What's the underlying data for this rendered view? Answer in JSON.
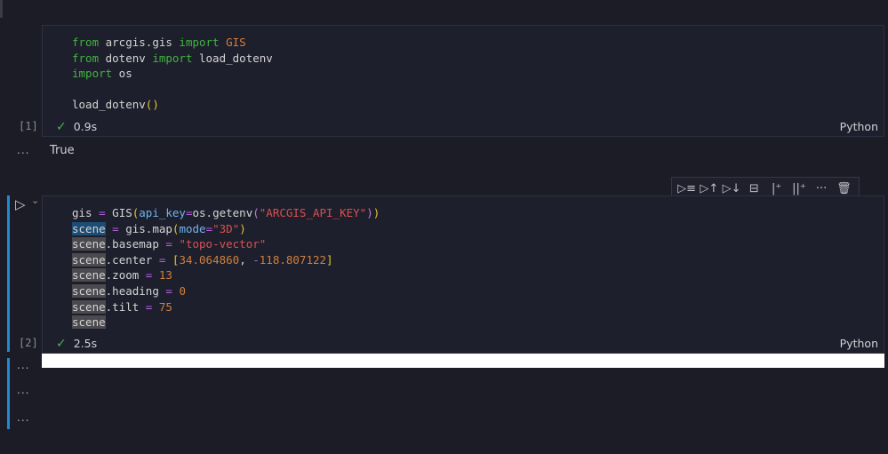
{
  "cells": [
    {
      "count": "[1]",
      "time": "0.9s",
      "language": "Python",
      "lines": [
        [
          [
            "from",
            "kw"
          ],
          [
            " arcgis.gis ",
            ""
          ],
          [
            "import",
            "kw"
          ],
          [
            " ",
            ""
          ],
          [
            "GIS",
            "cls"
          ]
        ],
        [
          [
            "from",
            "kw"
          ],
          [
            " dotenv ",
            ""
          ],
          [
            "import",
            "kw"
          ],
          [
            " load_dotenv",
            ""
          ]
        ],
        [
          [
            "import",
            "kw"
          ],
          [
            " os",
            ""
          ]
        ],
        [],
        [
          [
            "load_dotenv",
            ""
          ],
          [
            "()",
            "par"
          ]
        ]
      ],
      "output": "True"
    },
    {
      "count": "[2]",
      "time": "2.5s",
      "language": "Python",
      "lines": [
        [
          [
            "gis ",
            ""
          ],
          [
            "=",
            "op"
          ],
          [
            " GIS",
            ""
          ],
          [
            "(",
            "par"
          ],
          [
            "api_key",
            "arg"
          ],
          [
            "=",
            "op"
          ],
          [
            "os.getenv",
            ""
          ],
          [
            "(",
            "par2"
          ],
          [
            "\"ARCGIS_API_KEY\"",
            "str"
          ],
          [
            ")",
            "par2"
          ],
          [
            ")",
            "par"
          ]
        ],
        [
          [
            "scene",
            "hls"
          ],
          [
            " ",
            ""
          ],
          [
            "=",
            "op"
          ],
          [
            " gis.map",
            ""
          ],
          [
            "(",
            "par"
          ],
          [
            "mode",
            "arg"
          ],
          [
            "=",
            "op"
          ],
          [
            "\"3D\"",
            "str"
          ],
          [
            ")",
            "par"
          ]
        ],
        [
          [
            "scene",
            "hl"
          ],
          [
            ".basemap ",
            ""
          ],
          [
            "=",
            "op"
          ],
          [
            " ",
            ""
          ],
          [
            "\"topo-vector\"",
            "str"
          ]
        ],
        [
          [
            "scene",
            "hl"
          ],
          [
            ".center ",
            ""
          ],
          [
            "=",
            "op"
          ],
          [
            " ",
            ""
          ],
          [
            "[",
            "par"
          ],
          [
            "34.064860",
            "num"
          ],
          [
            ", ",
            ""
          ],
          [
            "-",
            "op"
          ],
          [
            "118.807122",
            "num"
          ],
          [
            "]",
            "par"
          ]
        ],
        [
          [
            "scene",
            "hl"
          ],
          [
            ".zoom ",
            ""
          ],
          [
            "=",
            "op"
          ],
          [
            " ",
            ""
          ],
          [
            "13",
            "num"
          ]
        ],
        [
          [
            "scene",
            "hl"
          ],
          [
            ".heading ",
            ""
          ],
          [
            "=",
            "op"
          ],
          [
            " ",
            ""
          ],
          [
            "0",
            "num"
          ]
        ],
        [
          [
            "scene",
            "hl"
          ],
          [
            ".tilt ",
            ""
          ],
          [
            "=",
            "op"
          ],
          [
            " ",
            ""
          ],
          [
            "75",
            "num"
          ]
        ],
        [
          [
            "scene",
            "hl"
          ]
        ]
      ]
    }
  ],
  "output_more": "...",
  "toolbar": [
    {
      "name": "execute-above-icon",
      "glyph": "▷≡"
    },
    {
      "name": "run-above-icon",
      "glyph": "▷↑"
    },
    {
      "name": "run-below-icon",
      "glyph": "▷↓"
    },
    {
      "name": "split-cell-icon",
      "glyph": "⊟"
    },
    {
      "name": "add-cell-above-icon",
      "glyph": "|⁺"
    },
    {
      "name": "add-cell-below-icon",
      "glyph": "||⁺"
    },
    {
      "name": "more-icon",
      "glyph": "···"
    },
    {
      "name": "trash-icon",
      "glyph": "🗑"
    }
  ],
  "check": "✓",
  "run_icon": "▷",
  "chevron": "⌄"
}
